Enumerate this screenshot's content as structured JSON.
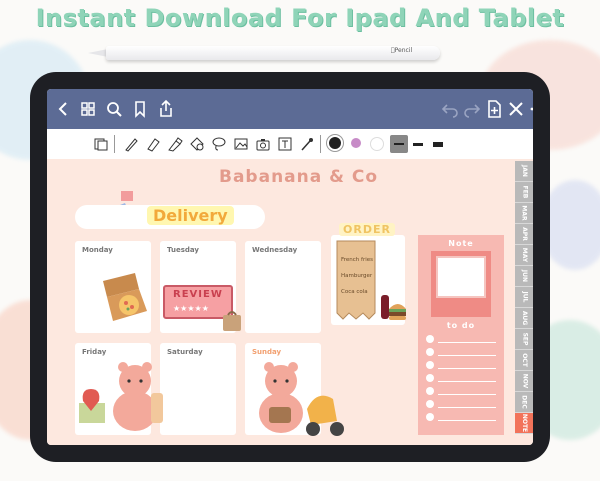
{
  "headline": "Instant Download For Ipad And Tablet",
  "pencil": {
    "brand": "Pencil"
  },
  "topbar": {
    "back_icon": "chevron-left-icon",
    "grid_icon": "grid-icon",
    "search_icon": "search-icon",
    "bookmark_icon": "bookmark-icon",
    "share_icon": "share-icon",
    "undo_icon": "undo-icon",
    "redo_icon": "redo-icon",
    "add_page_icon": "add-page-icon",
    "close_icon": "close-icon",
    "more_icon": "more-icon",
    "color": "#5c6b95"
  },
  "toolbar": {
    "tools": [
      "layers-icon",
      "pen-icon",
      "eraser-icon",
      "highlighter-icon",
      "shapes-icon",
      "lasso-icon",
      "image-icon",
      "camera-icon",
      "text-icon",
      "laser-icon"
    ],
    "colors": [
      "#222222",
      "#c78bc7"
    ],
    "stroke_widths": [
      "thin",
      "medium",
      "thick"
    ]
  },
  "planner": {
    "title": "Babanana & Co",
    "delivery": "Delivery",
    "days": [
      "Monday",
      "Tuesday",
      "Wednesday",
      "Friday",
      "Saturday",
      "Sunday"
    ],
    "review": "REVIEW",
    "order": {
      "title": "ORDER",
      "items": [
        "French fries",
        "Hamburger",
        "Coca cola"
      ]
    },
    "note": {
      "title": "Note",
      "todo": "to do"
    },
    "months": [
      "JAN",
      "FEB",
      "MAR",
      "APR",
      "MAY",
      "JUN",
      "JUL",
      "AUG",
      "SEP",
      "OCT",
      "NOV",
      "DEC",
      "NOTE"
    ]
  }
}
